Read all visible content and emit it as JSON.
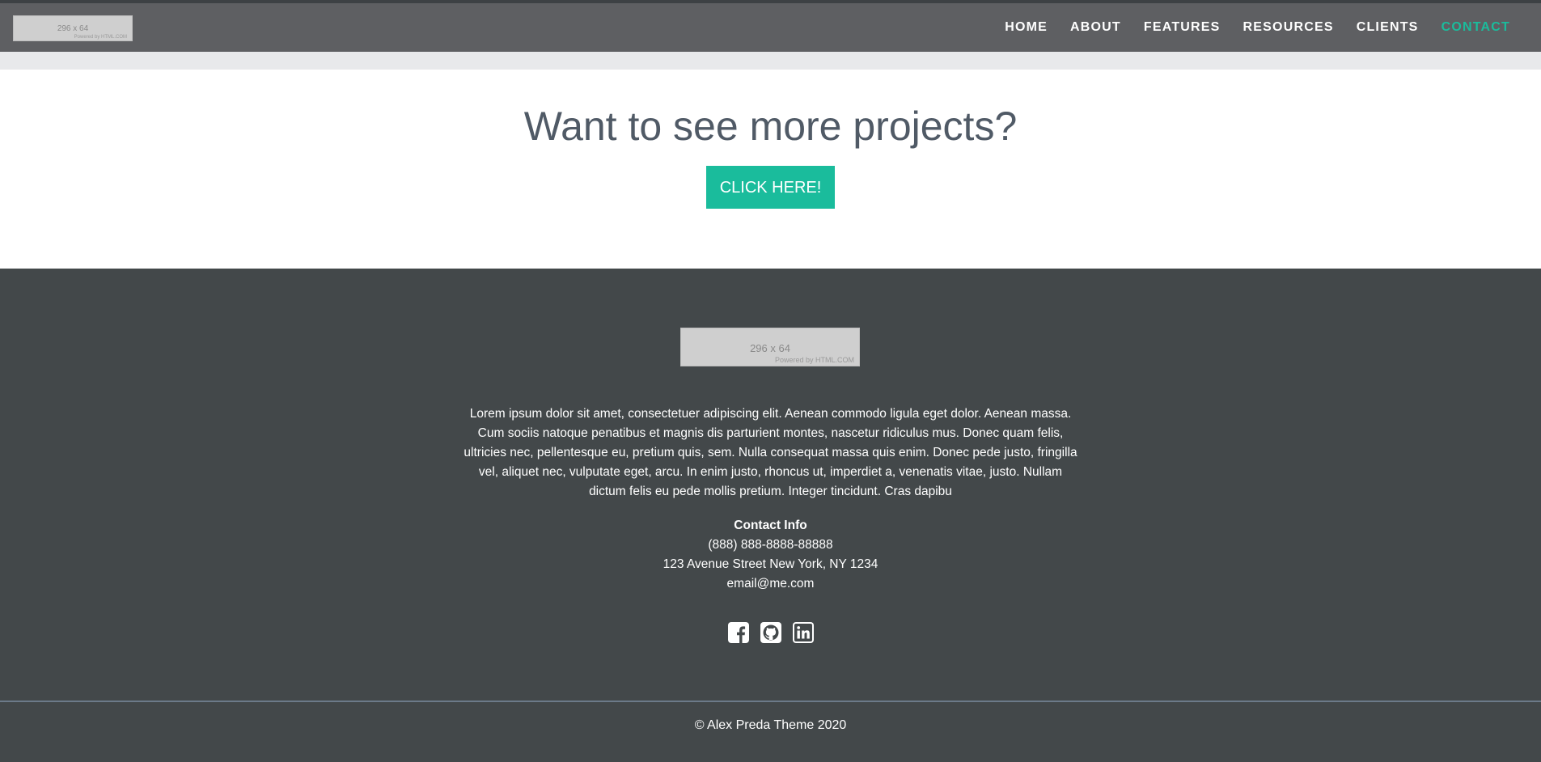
{
  "colors": {
    "navbar": "#5e5f62",
    "accent": "#1abc9c",
    "footer": "#43484a",
    "cta_title": "#505a66"
  },
  "header": {
    "logo": {
      "dimensions": "296 x 64",
      "powered_by": "Powered by HTML.COM"
    },
    "nav": [
      {
        "label": "HOME"
      },
      {
        "label": "ABOUT"
      },
      {
        "label": "FEATURES"
      },
      {
        "label": "RESOURCES"
      },
      {
        "label": "CLIENTS"
      },
      {
        "label": "CONTACT",
        "active": true
      }
    ]
  },
  "cta": {
    "title": "Want to see more projects?",
    "button_label": "CLICK HERE!"
  },
  "footer": {
    "logo": {
      "dimensions": "296 x 64",
      "powered_by": "Powered by HTML.COM"
    },
    "description": "Lorem ipsum dolor sit amet, consectetuer adipiscing elit. Aenean commodo ligula eget dolor. Aenean massa. Cum sociis natoque penatibus et magnis dis parturient montes, nascetur ridiculus mus. Donec quam felis, ultricies nec, pellentesque eu, pretium quis, sem. Nulla consequat massa quis enim. Donec pede justo, fringilla vel, aliquet nec, vulputate eget, arcu. In enim justo, rhoncus ut, imperdiet a, venenatis vitae, justo. Nullam dictum felis eu pede mollis pretium. Integer tincidunt. Cras dapibu",
    "contact": {
      "title": "Contact Info",
      "phone": "(888) 888-8888-88888",
      "address": "123 Avenue Street New York, NY 1234",
      "email": "email@me.com"
    },
    "socials": [
      {
        "icon": "facebook-icon"
      },
      {
        "icon": "github-icon"
      },
      {
        "icon": "linkedin-icon"
      }
    ],
    "copyright": "© Alex Preda Theme 2020"
  }
}
